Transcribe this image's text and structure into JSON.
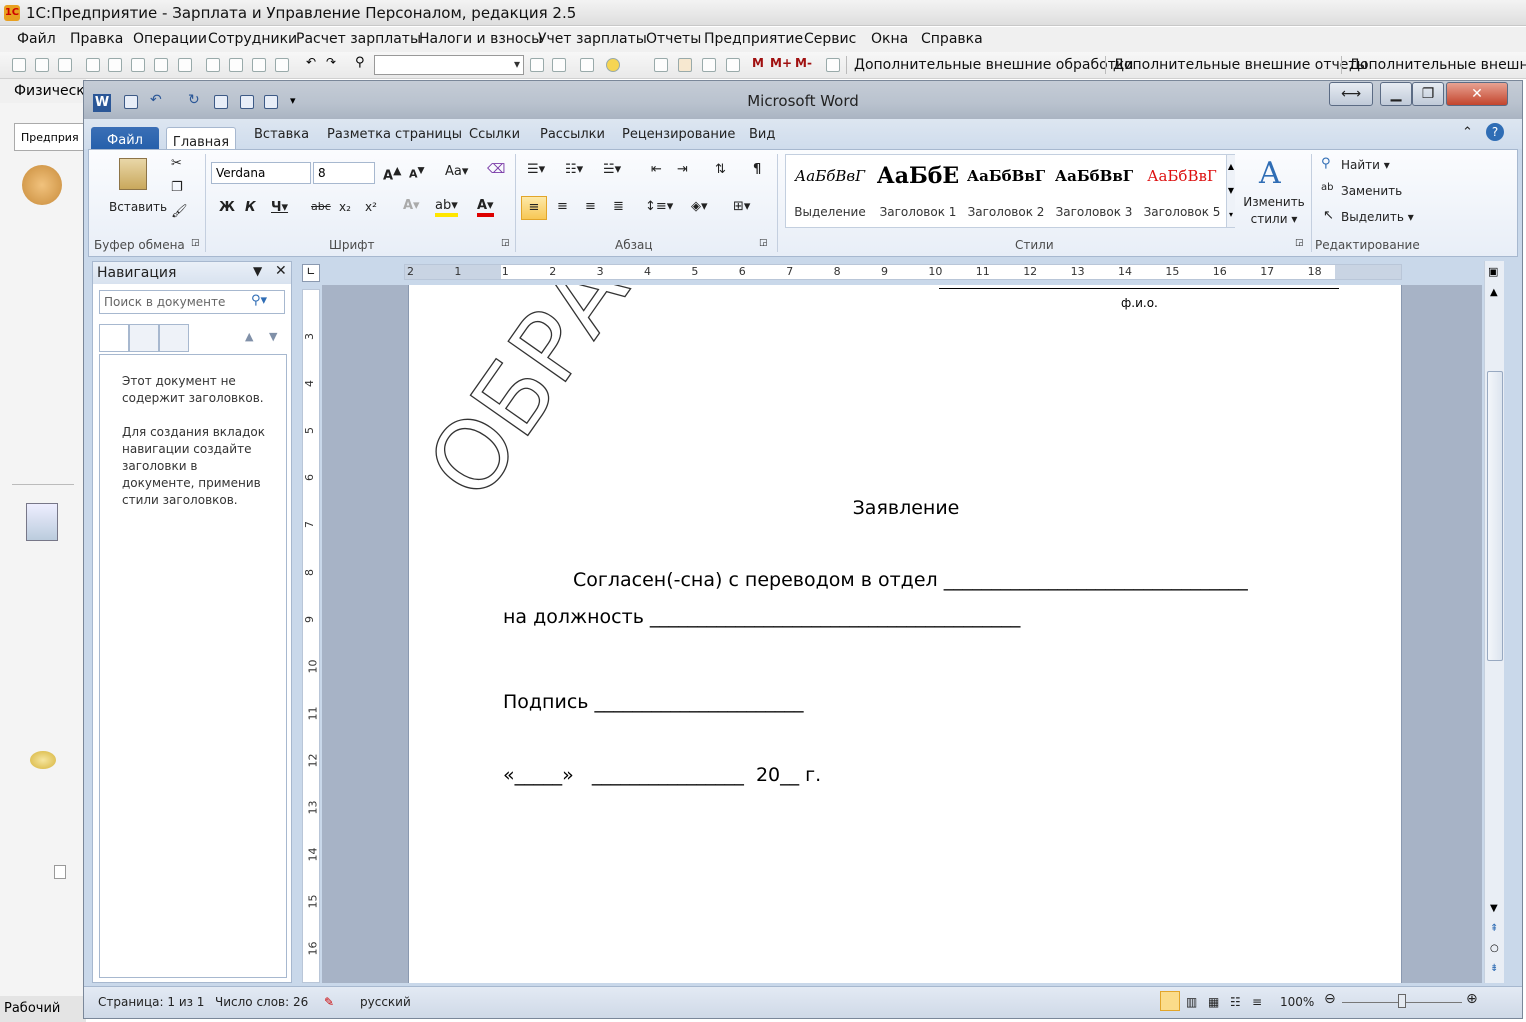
{
  "outer": {
    "title": "1С:Предприятие - Зарплата и Управление Персоналом, редакция 2.5",
    "menu": [
      "Файл",
      "Правка",
      "Операции",
      "Сотрудники",
      "Расчет зарплаты",
      "Налоги и взносы",
      "Учет зарплаты",
      "Отчеты",
      "Предприятие",
      "Сервис",
      "Окна",
      "Справка"
    ],
    "toolbar_links": [
      "Дополнительные внешние обработки",
      "Дополнительные внешние отчеты",
      "Дополнительные внешние п"
    ],
    "row2_label": "Физическ",
    "left_tab": "Предприя",
    "bottom_tab": "Рабочий"
  },
  "word": {
    "title": "Microsoft Word",
    "tabs": [
      "Файл",
      "Главная",
      "Вставка",
      "Разметка страницы",
      "Ссылки",
      "Рассылки",
      "Рецензирование",
      "Вид"
    ],
    "ribbon": {
      "paste": "Вставить",
      "font_name": "Verdana",
      "font_size": "8",
      "groups": [
        "Буфер обмена",
        "Шрифт",
        "Абзац",
        "Стили",
        "Редактирование"
      ],
      "styles": [
        {
          "preview": "АаБбВвГ",
          "name": "Выделение"
        },
        {
          "preview": "АаБбЕ",
          "name": "Заголовок 1"
        },
        {
          "preview": "АаБбВвГ",
          "name": "Заголовок 2"
        },
        {
          "preview": "АаБбВвГ",
          "name": "Заголовок 3"
        },
        {
          "preview": "АаБбВвГ",
          "name": "Заголовок 5"
        }
      ],
      "change_styles": [
        "Изменить",
        "стили"
      ],
      "find": "Найти",
      "replace": "Заменить",
      "select": "Выделить"
    },
    "nav": {
      "title": "Навигация",
      "search_placeholder": "Поиск в документе",
      "msg1": "Этот документ не содержит заголовков.",
      "msg2": "Для создания вкладок навигации создайте заголовки в документе, применив стили заголовков."
    },
    "ruler_h": [
      "2",
      "1",
      "1",
      "2",
      "3",
      "4",
      "5",
      "6",
      "7",
      "8",
      "9",
      "10",
      "11",
      "12",
      "13",
      "14",
      "15",
      "16",
      "17",
      "18"
    ],
    "ruler_v": [
      "3",
      "4",
      "5",
      "6",
      "7",
      "8",
      "9",
      "10",
      "11",
      "12",
      "13",
      "14",
      "15",
      "16"
    ],
    "document": {
      "watermark": "ОБРАЗЕЦ",
      "fio": "ф.и.о.",
      "heading": "Заявление",
      "line1": "Согласен(-сна) с переводом в отдел ________________________________",
      "line2": "на  должность _______________________________________",
      "signature": "Подпись ______________________",
      "date": "«_____»   ________________  20__ г."
    },
    "status": {
      "page": "Страница: 1 из 1",
      "words": "Число слов: 26",
      "lang": "русский",
      "zoom": "100%"
    }
  }
}
